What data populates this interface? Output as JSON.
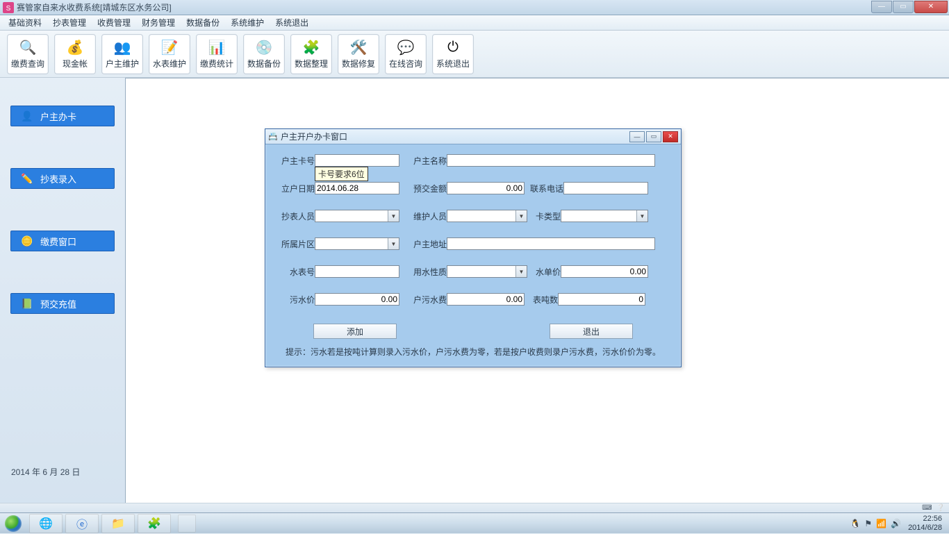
{
  "titlebar": {
    "title": "赛管家自来水收费系统[靖城东区水务公司]"
  },
  "menubar": {
    "items": [
      "基础资料",
      "抄表管理",
      "收费管理",
      "财务管理",
      "数据备份",
      "系统维护",
      "系统退出"
    ]
  },
  "toolbar": {
    "items": [
      {
        "label": "缴费查询",
        "icon": "🔍"
      },
      {
        "label": "现金帐",
        "icon": "💰"
      },
      {
        "label": "户主维护",
        "icon": "👥"
      },
      {
        "label": "水表维护",
        "icon": "📝"
      },
      {
        "label": "缴费统计",
        "icon": "📊"
      },
      {
        "label": "数据备份",
        "icon": "💿"
      },
      {
        "label": "数据整理",
        "icon": "🧩"
      },
      {
        "label": "数据修复",
        "icon": "🛠️"
      },
      {
        "label": "在线咨询",
        "icon": "💬"
      },
      {
        "label": "系统退出",
        "icon": "⏻"
      }
    ]
  },
  "sidebar": {
    "items": [
      {
        "label": "户主办卡",
        "icon": "👤"
      },
      {
        "label": "抄表录入",
        "icon": "✏️"
      },
      {
        "label": "缴费窗口",
        "icon": "🪙"
      },
      {
        "label": "预交充值",
        "icon": "📗"
      }
    ],
    "date": "2014 年   6 月 28 日"
  },
  "dialog": {
    "title": "户主开户办卡窗口",
    "tooltip": "卡号要求6位",
    "fields": {
      "card_no": {
        "label": "户主卡号",
        "value": ""
      },
      "owner_name": {
        "label": "户主名称",
        "value": ""
      },
      "open_date": {
        "label": "立户日期",
        "value": "2014.06.28"
      },
      "prepay": {
        "label": "预交金额",
        "value": "0.00"
      },
      "phone": {
        "label": "联系电话",
        "value": ""
      },
      "reader": {
        "label": "抄表人员",
        "value": ""
      },
      "maintainer": {
        "label": "维护人员",
        "value": ""
      },
      "card_type": {
        "label": "卡类型",
        "value": ""
      },
      "area": {
        "label": "所属片区",
        "value": ""
      },
      "address": {
        "label": "户主地址",
        "value": ""
      },
      "meter_no": {
        "label": "水表号",
        "value": ""
      },
      "water_kind": {
        "label": "用水性质",
        "value": ""
      },
      "water_price": {
        "label": "水单价",
        "value": "0.00"
      },
      "sewage_price": {
        "label": "污水价",
        "value": "0.00"
      },
      "sewage_fee": {
        "label": "户污水费",
        "value": "0.00"
      },
      "meter_ton": {
        "label": "表吨数",
        "value": "0"
      }
    },
    "buttons": {
      "add": "添加",
      "exit": "退出"
    },
    "hint": "提示：污水若是按吨计算则录入污水价，户污水费为零，若是按户收费则录户污水费，污水价价为零。"
  },
  "taskbar": {
    "running": "",
    "clock": {
      "time": "22:56",
      "date": "2014/6/28"
    }
  },
  "status": {
    "left": "⌨",
    "right": "❔"
  }
}
